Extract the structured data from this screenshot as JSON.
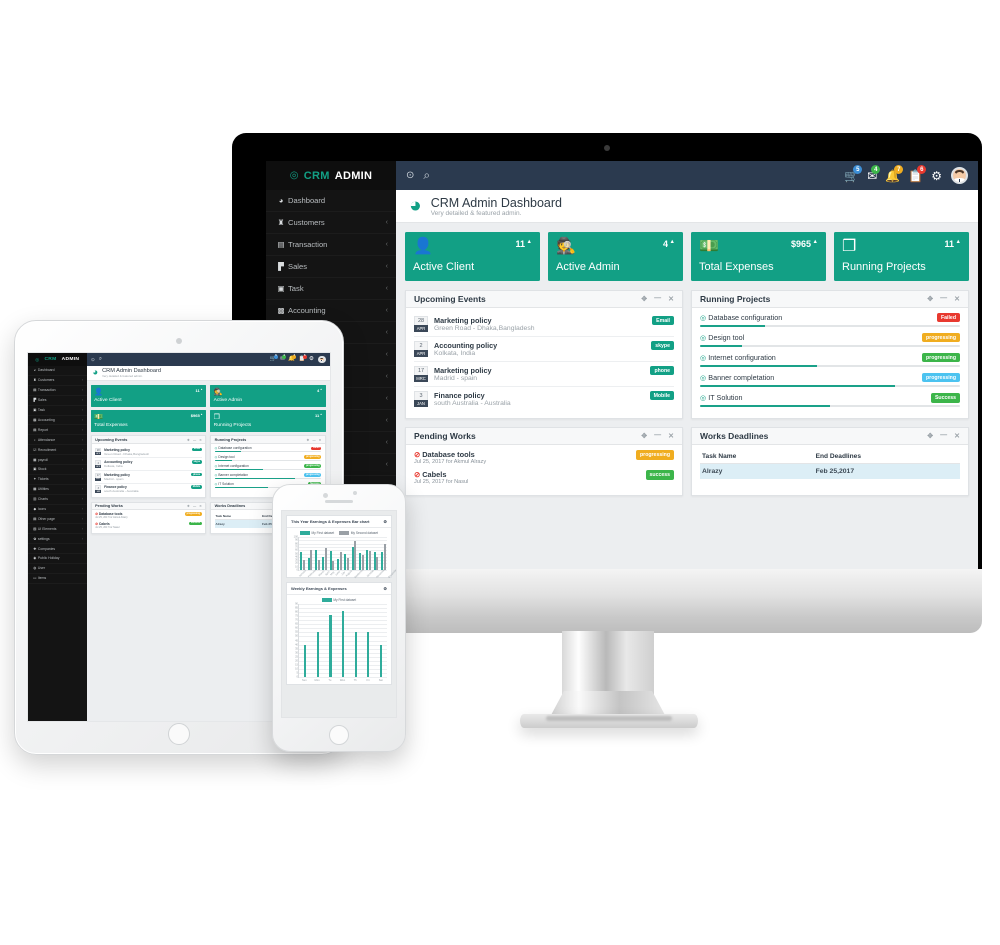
{
  "brand": {
    "mark": "◉",
    "crm": "CRM",
    "admin": "ADMIN"
  },
  "topbar": {
    "collapse_icon": "‹",
    "search_icon": "search-icon",
    "icons": [
      {
        "name": "cart-icon",
        "glyph": "cart",
        "badge": "5",
        "badge_color": "#3d8fd6"
      },
      {
        "name": "mail-icon",
        "glyph": "mail",
        "badge": "4",
        "badge_color": "#3cb54a"
      },
      {
        "name": "bell-icon",
        "glyph": "bell",
        "badge": "7",
        "badge_color": "#f0ad20"
      },
      {
        "name": "clipboard-icon",
        "glyph": "clipboard",
        "badge": "6",
        "badge_color": "#e8392f"
      },
      {
        "name": "gear-icon",
        "glyph": "gear",
        "badge": "",
        "badge_color": ""
      }
    ]
  },
  "page": {
    "icon": "dashboard-gauge-icon",
    "title": "CRM Admin Dashboard",
    "subtitle": "Very detailed & featured admin."
  },
  "sidebar": {
    "items": [
      {
        "label": "Dashboard",
        "icon": "gauge-icon",
        "caret": ""
      },
      {
        "label": "Customers",
        "icon": "users-icon",
        "caret": "‹"
      },
      {
        "label": "Transaction",
        "icon": "briefcase-icon",
        "caret": "‹"
      },
      {
        "label": "Sales",
        "icon": "cart-icon",
        "caret": "‹"
      },
      {
        "label": "Task",
        "icon": "clipboard-icon",
        "caret": "‹"
      },
      {
        "label": "Accounting",
        "icon": "bag-icon",
        "caret": "‹"
      },
      {
        "label": "Report",
        "icon": "file-icon",
        "caret": "‹"
      },
      {
        "label": "Attendance",
        "icon": "bell-icon",
        "caret": "‹"
      },
      {
        "label": "Recruitment",
        "icon": "check-icon",
        "caret": "‹"
      },
      {
        "label": "payroll",
        "icon": "wallet-icon",
        "caret": "‹"
      },
      {
        "label": "Stock",
        "icon": "box-icon",
        "caret": "‹"
      },
      {
        "label": "Tickets",
        "icon": "ticket-icon",
        "caret": "‹"
      },
      {
        "label": "Utilities",
        "icon": "grid-icon",
        "caret": "‹"
      },
      {
        "label": "Charts",
        "icon": "chart-icon",
        "caret": "‹"
      },
      {
        "label": "Icons",
        "icon": "star-icon",
        "caret": "‹"
      },
      {
        "label": "Other page",
        "icon": "pages-icon",
        "caret": "‹"
      },
      {
        "label": "UI Elements",
        "icon": "layers-icon",
        "caret": "‹"
      },
      {
        "label": "settings",
        "icon": "gear-icon",
        "caret": "‹"
      },
      {
        "label": "Companies",
        "icon": "building-icon",
        "caret": ""
      },
      {
        "label": "Public Holiday",
        "icon": "calendar-icon",
        "caret": ""
      },
      {
        "label": "User",
        "icon": "user-icon",
        "caret": ""
      },
      {
        "label": "Items",
        "icon": "doc-icon",
        "caret": ""
      }
    ]
  },
  "kpis": [
    {
      "name": "active-client",
      "value": "11",
      "arrow": "▲",
      "label": "Active Client",
      "icon": "user-plus-icon"
    },
    {
      "name": "active-admin",
      "value": "4",
      "arrow": "▲",
      "label": "Active Admin",
      "icon": "admin-hat-icon"
    },
    {
      "name": "total-expenses",
      "value": "$965",
      "arrow": "▲",
      "label": "Total Expenses",
      "icon": "money-icon"
    },
    {
      "name": "running-projects",
      "value": "11",
      "arrow": "▲",
      "label": "Running Projects",
      "icon": "copy-icon"
    }
  ],
  "panel_tools": {
    "move": "✥",
    "minimize": "—",
    "close": "✕"
  },
  "upcoming_events": {
    "title": "Upcoming Events",
    "items": [
      {
        "day": "28",
        "month": "APR",
        "title": "Marketing policy",
        "sub": "Green Road - Dhaka,Bangladesh",
        "tag": "Email",
        "tag_color": "#12a085"
      },
      {
        "day": "2",
        "month": "APR",
        "title": "Accounting policy",
        "sub": "Kolkata, India",
        "tag": "skype",
        "tag_color": "#12a085"
      },
      {
        "day": "17",
        "month": "MRC",
        "title": "Marketing policy",
        "sub": "Madrid - spain",
        "tag": "phone",
        "tag_color": "#12a085"
      },
      {
        "day": "3",
        "month": "JAN",
        "title": "Finance policy",
        "sub": "south Australia - Australia",
        "tag": "Mobile",
        "tag_color": "#12a085"
      }
    ]
  },
  "running_projects": {
    "title": "Running Projects",
    "items": [
      {
        "name": "Database configuration",
        "progress": 25,
        "tag": "Failed",
        "tag_color": "#e8392f"
      },
      {
        "name": "Design tool",
        "progress": 16,
        "tag": "progressing",
        "tag_color": "#f0ad20"
      },
      {
        "name": "Internet configuration",
        "progress": 45,
        "tag": "progressing",
        "tag_color": "#3cb54a"
      },
      {
        "name": "Banner completation",
        "progress": 75,
        "tag": "progressing",
        "tag_color": "#4cc3f0"
      },
      {
        "name": "IT Solution",
        "progress": 50,
        "tag": "Success",
        "tag_color": "#3cb54a"
      }
    ]
  },
  "pending_works": {
    "title": "Pending Works",
    "items": [
      {
        "title": "Database tools",
        "sub": "Jul 25, 2017 for Akmul Alrazy",
        "tag": "progressing",
        "tag_color": "#f0ad20"
      },
      {
        "title": "Cabels",
        "sub": "Jul 25, 2017 for Nasul",
        "tag": "success",
        "tag_color": "#3cb54a"
      }
    ]
  },
  "works_deadlines": {
    "title": "Works Deadlines",
    "columns": [
      "Task Name",
      "End Deadlines"
    ],
    "rows": [
      {
        "task": "Alrazy",
        "deadline": "Feb 25,2017"
      }
    ]
  },
  "chart_data": [
    {
      "type": "bar",
      "title": "This Year Earnings & Expenses Bar chart",
      "categories": [
        "January",
        "February",
        "March",
        "April",
        "May",
        "June",
        "July",
        "August",
        "September",
        "October",
        "November",
        "December"
      ],
      "series": [
        {
          "name": "My First dataset",
          "color": "#2fac9b",
          "values": [
            55,
            35,
            62,
            40,
            58,
            32,
            48,
            70,
            52,
            60,
            54,
            56
          ]
        },
        {
          "name": "My Second dataset",
          "color": "#9aa0a6",
          "values": [
            30,
            62,
            30,
            66,
            26,
            55,
            36,
            88,
            44,
            58,
            40,
            80
          ]
        }
      ],
      "ylim": [
        0,
        100
      ],
      "yticks": [
        0,
        10,
        20,
        30,
        40,
        50,
        60,
        70,
        80,
        90,
        100
      ],
      "xlabel": "",
      "ylabel": "",
      "grid": true,
      "legend": "top"
    },
    {
      "type": "bar",
      "title": "Weekly Earnings & Expenses",
      "categories": [
        "Sun",
        "Mon",
        "Tu",
        "Wen",
        "Th",
        "Fri",
        "Sat"
      ],
      "series": [
        {
          "name": "My First dataset",
          "color": "#2fac9b",
          "values": [
            40,
            55,
            77,
            81,
            56,
            55,
            40
          ]
        }
      ],
      "ylim": [
        0,
        90
      ],
      "yticks": [
        0,
        5,
        10,
        15,
        20,
        25,
        30,
        35,
        40,
        45,
        50,
        55,
        60,
        65,
        70,
        75,
        80,
        85,
        90
      ],
      "xlabel": "",
      "ylabel": "",
      "grid": true,
      "legend": "top"
    }
  ],
  "colors": {
    "accent": "#12a085",
    "topbar": "#2b3a4f",
    "sidebar": "#141414",
    "app_bg": "#eceef0"
  }
}
